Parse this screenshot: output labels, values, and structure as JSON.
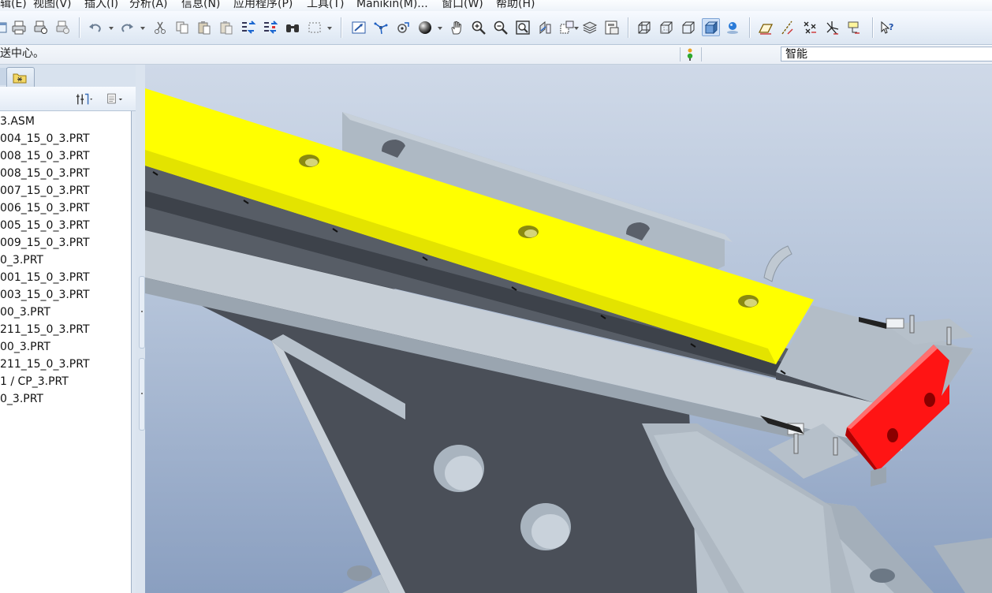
{
  "menu": {
    "items": [
      "辑(E)",
      "视图(V)",
      "插入(I)",
      "分析(A)",
      "信息(N)",
      "应用程序(P)",
      "工具(T)",
      "Manikin(M)...",
      "窗口(W)",
      "帮助(H)"
    ]
  },
  "toolbar": {
    "icons": [
      "new-window-icon",
      "print-icon",
      "print-preview-icon",
      "print-setup-icon",
      "undo-icon",
      "redo-icon",
      "cut-icon",
      "copy-icon",
      "paste-icon",
      "paste-special-icon",
      "regenerate-icon",
      "regenerate-manager-icon",
      "find-icon",
      "select-box-icon",
      "repaint-icon",
      "spin-center-icon",
      "orient-mode-icon",
      "appearance-sphere-icon",
      "pan-hand-icon",
      "zoom-in-icon",
      "zoom-out-icon",
      "refit-icon",
      "orient-icon",
      "saved-views-icon",
      "layers-icon",
      "view-manager-icon",
      "wireframe-icon",
      "hidden-line-icon",
      "no-hidden-icon",
      "shading-icon",
      "enhanced-realism-icon",
      "datum-planes-icon",
      "datum-axes-icon",
      "datum-points-icon",
      "coordinate-systems-icon",
      "annotations-icon",
      "context-help-icon"
    ]
  },
  "message_row": {
    "message": "送中心。",
    "filter_value": "智能",
    "status_light": "status-light-icon"
  },
  "model_tree": {
    "items": [
      "3.ASM",
      "004_15_0_3.PRT",
      "008_15_0_3.PRT",
      "008_15_0_3.PRT",
      "007_15_0_3.PRT",
      "006_15_0_3.PRT",
      "005_15_0_3.PRT",
      "009_15_0_3.PRT",
      "0_3.PRT",
      "001_15_0_3.PRT",
      "003_15_0_3.PRT",
      "00_3.PRT",
      "211_15_0_3.PRT",
      "00_3.PRT",
      "211_15_0_3.PRT",
      "1 / CP_3.PRT",
      "0_3.PRT"
    ],
    "tools": [
      "settings-icon",
      "show-icon"
    ],
    "tabs": [
      "model-tree-tab",
      "folder-browser-tab"
    ]
  },
  "colors": {
    "yellow_part": "#ffff00",
    "red_part": "#ff1414",
    "frame_light": "#b8c2cc",
    "frame_dark": "#4a4e56"
  }
}
